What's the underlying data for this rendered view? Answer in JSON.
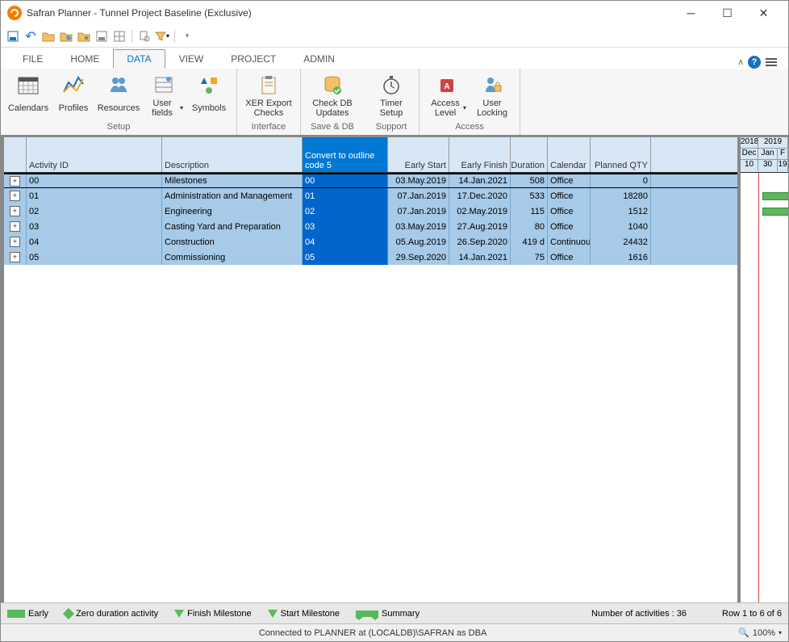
{
  "title": "Safran Planner - Tunnel Project Baseline (Exclusive)",
  "tabs": {
    "file": "FILE",
    "home": "HOME",
    "data": "DATA",
    "view": "VIEW",
    "project": "PROJECT",
    "admin": "ADMIN"
  },
  "ribbon": {
    "setup": {
      "label": "Setup",
      "calendars": "Calendars",
      "profiles": "Profiles",
      "resources": "Resources",
      "userfields": "User fields",
      "symbols": "Symbols"
    },
    "interface": {
      "label": "Interface",
      "xer": "XER Export Checks"
    },
    "savedb": {
      "label": "Save & DB",
      "checkdb": "Check DB Updates"
    },
    "support": {
      "label": "Support",
      "timer": "Timer Setup"
    },
    "access": {
      "label": "Access",
      "level": "Access Level",
      "locking": "User Locking"
    }
  },
  "columns": {
    "activityId": "Activity ID",
    "description": "Description",
    "convert": "Convert to outline code 5",
    "earlyStart": "Early Start",
    "earlyFinish": "Early Finish",
    "duration": "Duration",
    "calendar": "Calendar",
    "plannedQty": "Planned QTY"
  },
  "colWidths": {
    "exp": 28,
    "id": 168,
    "desc": 174,
    "conv": 106,
    "es": 76,
    "ef": 76,
    "dur": 46,
    "cal": 53,
    "qty": 75
  },
  "rows": [
    {
      "id": "00",
      "desc": "Milestones",
      "conv": "00",
      "es": "03.May.2019",
      "ef": "14.Jan.2021",
      "dur": "508",
      "cal": "Office",
      "qty": "0"
    },
    {
      "id": "01",
      "desc": "Administration and Management",
      "conv": "01",
      "es": "07.Jan.2019",
      "ef": "17.Dec.2020",
      "dur": "533",
      "cal": "Office",
      "qty": "18280"
    },
    {
      "id": "02",
      "desc": "Engineering",
      "conv": "02",
      "es": "07.Jan.2019",
      "ef": "02.May.2019",
      "dur": "115",
      "cal": "Office",
      "qty": "1512"
    },
    {
      "id": "03",
      "desc": "Casting Yard and Preparation",
      "conv": "03",
      "es": "03.May.2019",
      "ef": "27.Aug.2019",
      "dur": "80",
      "cal": "Office",
      "qty": "1040"
    },
    {
      "id": "04",
      "desc": "Construction",
      "conv": "04",
      "es": "05.Aug.2019",
      "ef": "26.Sep.2020",
      "dur": "419 d",
      "cal": "Continuou",
      "qty": "24432"
    },
    {
      "id": "05",
      "desc": "Commissioning",
      "conv": "05",
      "es": "29.Sep.2020",
      "ef": "14.Jan.2021",
      "dur": "75",
      "cal": "Office",
      "qty": "1616"
    }
  ],
  "gantt": {
    "years": [
      "2018",
      "2019"
    ],
    "months": [
      "Dec",
      "Jan",
      "F"
    ],
    "days": [
      "10",
      "30",
      "19"
    ]
  },
  "legend": {
    "early": "Early",
    "zero": "Zero duration activity",
    "finish": "Finish Milestone",
    "start": "Start Milestone",
    "summary": "Summary",
    "count": "Number of activities : 36",
    "rows": "Row 1 to 6 of 6"
  },
  "status": {
    "conn": "Connected to PLANNER at (LOCALDB)\\SAFRAN as DBA",
    "zoom": "100%"
  }
}
